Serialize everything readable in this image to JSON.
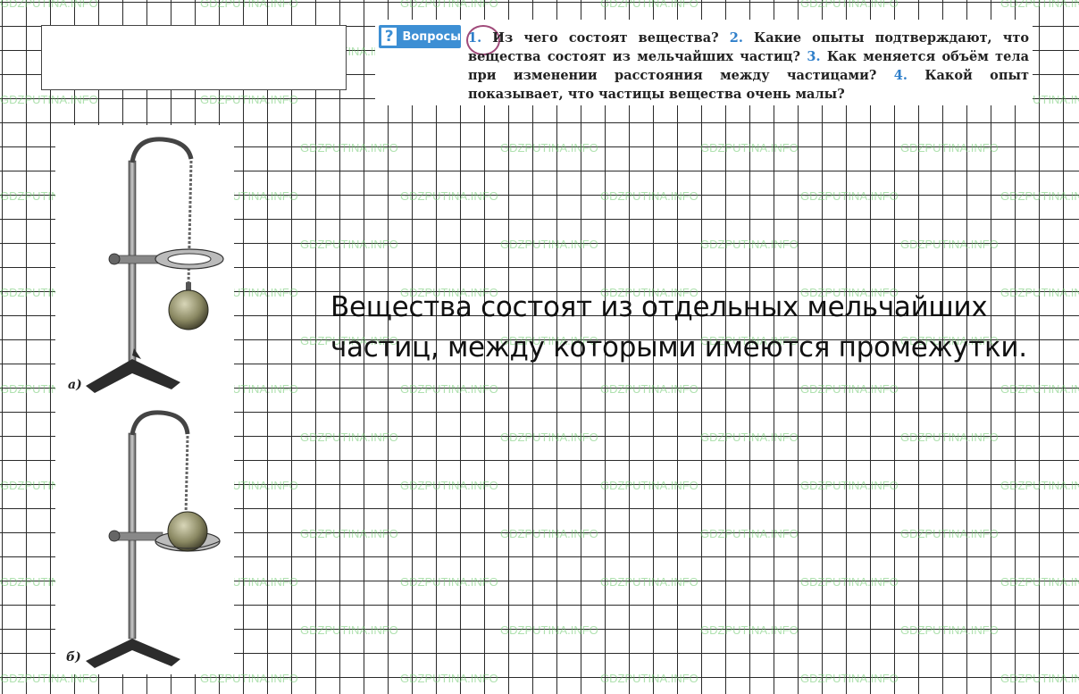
{
  "watermark": "GDZPUTINA.INFO",
  "questions": {
    "mark": "?",
    "label": "Вопросы",
    "items": [
      {
        "num": "1.",
        "text": "Из чего состоят вещества?"
      },
      {
        "num": "2.",
        "text": "Какие опыты подтверждают, что вещества состоят из мельчайших частиц?"
      },
      {
        "num": "3.",
        "text": "Как меняется объём тела при изменении расстояния между частицами?"
      },
      {
        "num": "4.",
        "text": "Какой опыт показывает, что частицы вещества очень малы?"
      }
    ]
  },
  "figure": {
    "label_a": "а)",
    "label_b": "б)"
  },
  "answer": {
    "line1": "Вещества состоят из отдельных мельчайших",
    "line2": "частиц, между которыми имеются промежутки."
  },
  "colors": {
    "accent": "#3d8fd4",
    "grid": "#2a2a2a",
    "watermark": "#6ec86e"
  }
}
